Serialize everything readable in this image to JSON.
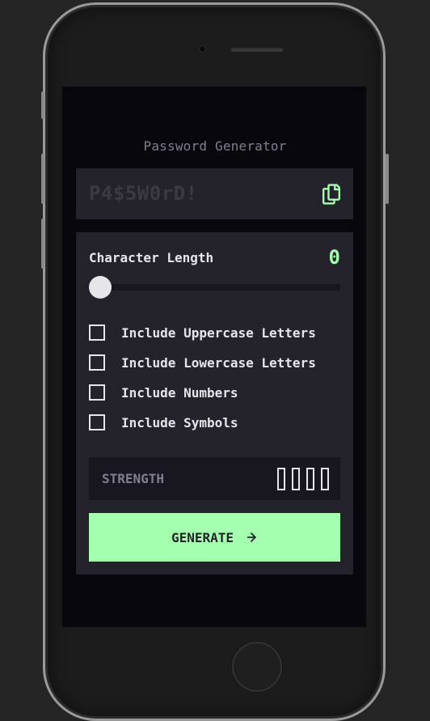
{
  "app": {
    "title": "Password Generator"
  },
  "password": {
    "placeholder": "P4$5W0rD!",
    "copy_icon": "copy-icon"
  },
  "length": {
    "label": "Character Length",
    "value": "0",
    "slider_level": 0
  },
  "options": [
    {
      "label": "Include Uppercase Letters",
      "checked": false
    },
    {
      "label": "Include Lowercase Letters",
      "checked": false
    },
    {
      "label": "Include Numbers",
      "checked": false
    },
    {
      "label": "Include Symbols",
      "checked": false
    }
  ],
  "strength": {
    "label": "STRENGTH",
    "level": 0,
    "bars_total": 4
  },
  "generate": {
    "label": "GENERATE",
    "icon": "arrow-right-icon"
  },
  "colors": {
    "accent": "#a4ffaf",
    "panel": "#24232c",
    "screen_bg": "#08070b",
    "text": "#e6e5ea",
    "muted": "#817d92"
  }
}
